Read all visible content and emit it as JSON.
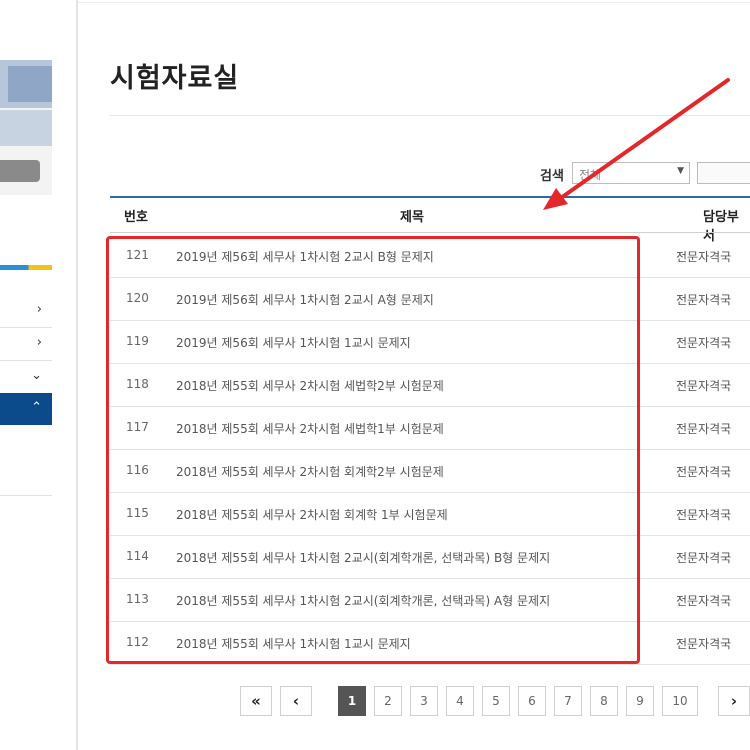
{
  "page": {
    "title": "시험자료실"
  },
  "search": {
    "label": "검색",
    "select_value": "전체",
    "input_value": ""
  },
  "table": {
    "headers": [
      "번호",
      "제목",
      "담당부서"
    ],
    "rows": [
      {
        "num": "121",
        "subject": "2019년 제56회 세무사 1차시험 2교시 B형 문제지",
        "dept": "전문자격국"
      },
      {
        "num": "120",
        "subject": "2019년 제56회 세무사 1차시험 2교시 A형 문제지",
        "dept": "전문자격국"
      },
      {
        "num": "119",
        "subject": "2019년 제56회 세무사 1차시험 1교시 문제지",
        "dept": "전문자격국"
      },
      {
        "num": "118",
        "subject": "2018년 제55회 세무사 2차시험 세법학2부 시험문제",
        "dept": "전문자격국"
      },
      {
        "num": "117",
        "subject": "2018년 제55회 세무사 2차시험 세법학1부 시험문제",
        "dept": "전문자격국"
      },
      {
        "num": "116",
        "subject": "2018년 제55회 세무사 2차시험 회계학2부 시험문제",
        "dept": "전문자격국"
      },
      {
        "num": "115",
        "subject": "2018년 제55회 세무사 2차시험 회계학 1부 시험문제",
        "dept": "전문자격국"
      },
      {
        "num": "114",
        "subject": "2018년 제55회 세무사 1차시험 2교시(회계학개론, 선택과목) B형 문제지",
        "dept": "전문자격국"
      },
      {
        "num": "113",
        "subject": "2018년 제55회 세무사 1차시험 2교시(회계학개론, 선택과목) A형 문제지",
        "dept": "전문자격국"
      },
      {
        "num": "112",
        "subject": "2018년 제55회 세무사 1차시험 1교시 문제지",
        "dept": "전문자격국"
      }
    ]
  },
  "pagination": {
    "first": "«",
    "prev": "‹",
    "pages": [
      "1",
      "2",
      "3",
      "4",
      "5",
      "6",
      "7",
      "8",
      "9",
      "10"
    ],
    "current": "1",
    "next": "›"
  },
  "sidebar": {
    "chevrons": [
      "›",
      "›",
      "⌄",
      "⌃"
    ]
  },
  "colors": {
    "accent_blue": "#0b4a8b",
    "table_top_line": "#2d6aa6",
    "highlight_red": "#e3272a",
    "pager_current": "#555555"
  },
  "icons": {
    "sidebar_chevron": "chevron-right-icon",
    "select_arrow": "caret-down-icon",
    "annotation": "red-arrow-annotation"
  }
}
